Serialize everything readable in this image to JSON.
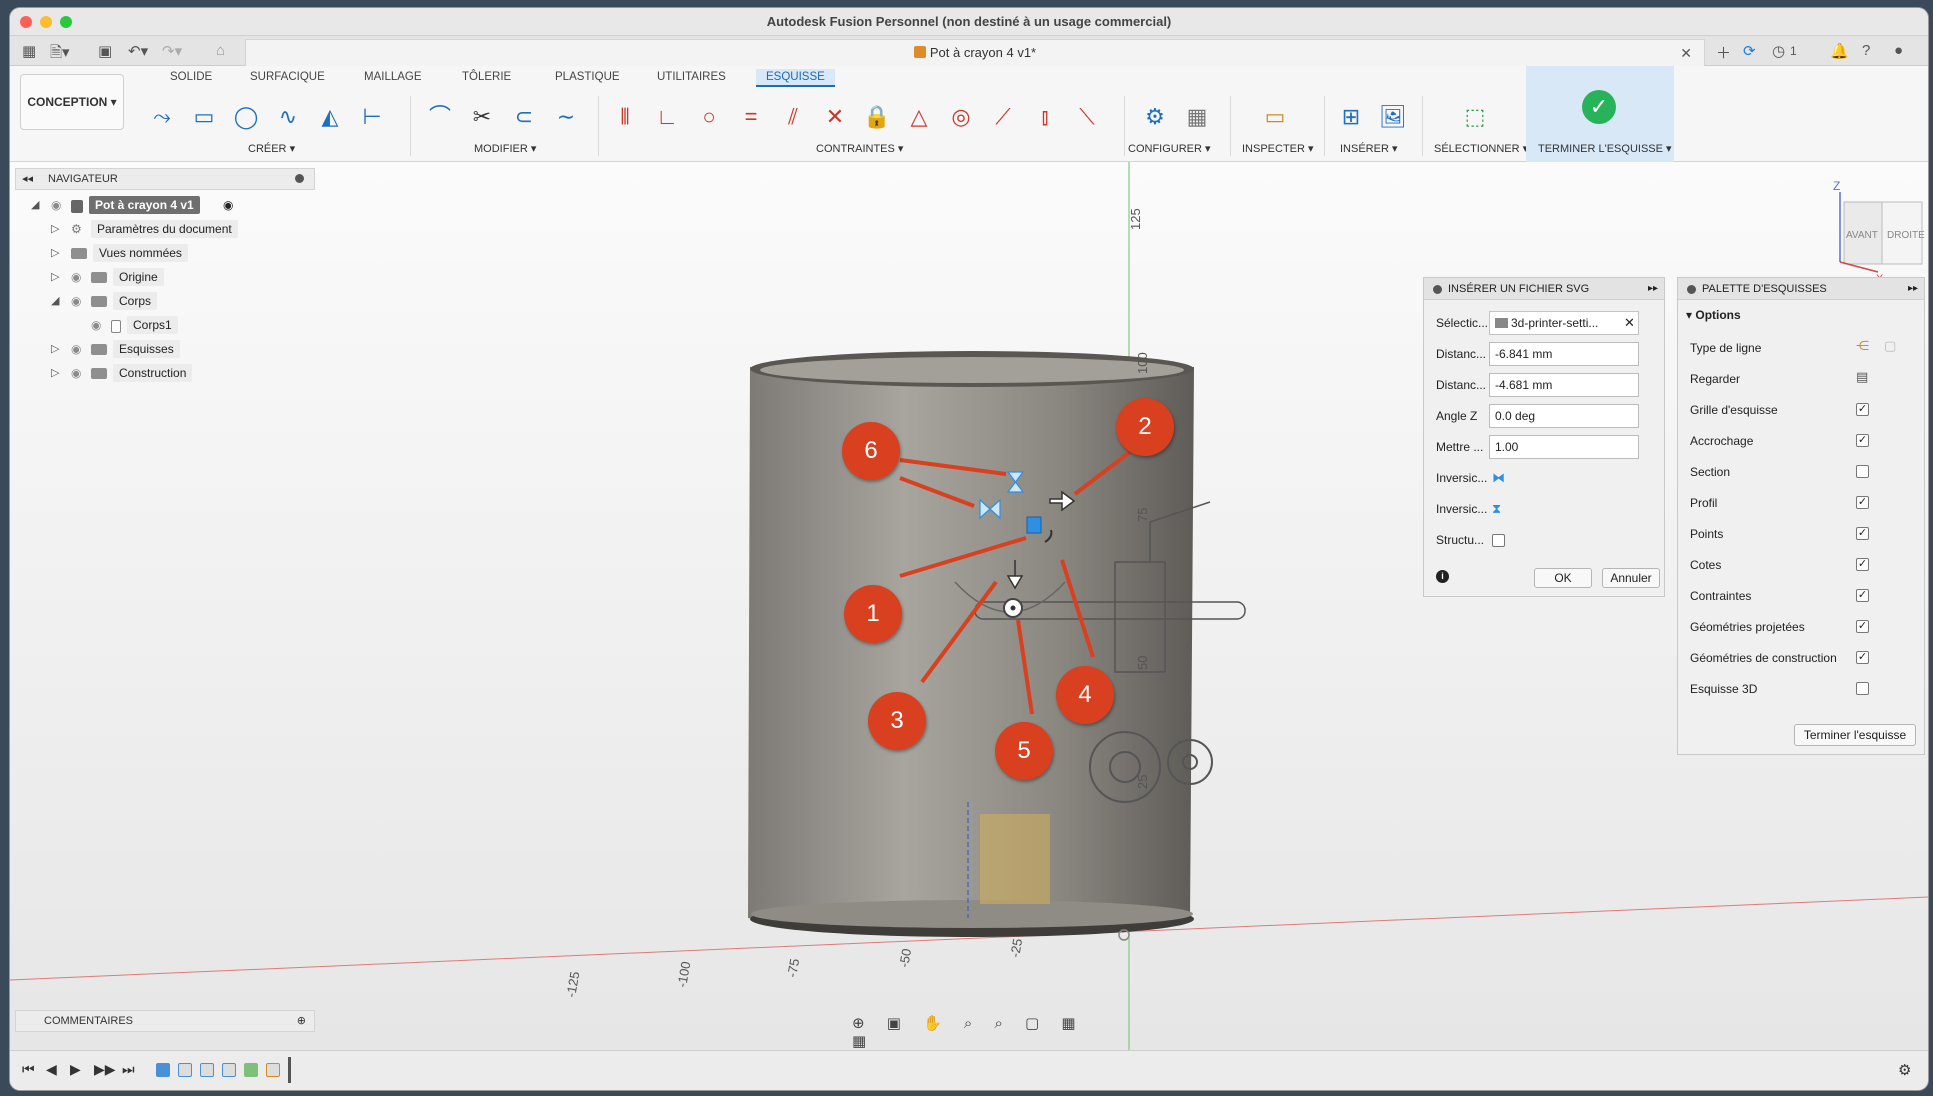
{
  "window": {
    "title": "Autodesk Fusion Personnel (non destiné à un usage commercial)"
  },
  "document_tab": {
    "title": "Pot à crayon 4 v1*"
  },
  "top_right": {
    "badge_count": "1"
  },
  "toolbar": {
    "workspace": "CONCEPTION",
    "tabs": [
      "SOLIDE",
      "SURFACIQUE",
      "MAILLAGE",
      "TÔLERIE",
      "PLASTIQUE",
      "UTILITAIRES",
      "ESQUISSE"
    ],
    "active_tab": "ESQUISSE",
    "groups": {
      "create": "CRÉER",
      "modify": "MODIFIER",
      "constraints": "CONTRAINTES",
      "configure": "CONFIGURER",
      "inspect": "INSPECTER",
      "insert": "INSÉRER",
      "select": "SÉLECTIONNER",
      "finish": "TERMINER L'ESQUISSE"
    }
  },
  "navigator": {
    "title": "NAVIGATEUR",
    "items": [
      {
        "label": "Pot à crayon 4 v1"
      },
      {
        "label": "Paramètres du document"
      },
      {
        "label": "Vues nommées"
      },
      {
        "label": "Origine"
      },
      {
        "label": "Corps"
      },
      {
        "label": "Corps1"
      },
      {
        "label": "Esquisses"
      },
      {
        "label": "Construction"
      }
    ]
  },
  "comments": {
    "title": "COMMENTAIRES"
  },
  "svg_dialog": {
    "title": "INSÉRER UN FICHIER SVG",
    "select_label": "Sélectic...",
    "file_name": "3d-printer-setti...",
    "rows": [
      {
        "label": "Distanc...",
        "value": "-6.841 mm"
      },
      {
        "label": "Distanc...",
        "value": "-4.681 mm"
      },
      {
        "label": "Angle Z",
        "value": "0.0 deg"
      },
      {
        "label": "Mettre ...",
        "value": "1.00"
      }
    ],
    "flip_h_label": "Inversic...",
    "flip_v_label": "Inversic...",
    "structure_label": "Structu...",
    "ok": "OK",
    "cancel": "Annuler"
  },
  "palette": {
    "title": "PALETTE D'ESQUISSES",
    "section": "Options",
    "line_type_label": "Type de ligne",
    "look_label": "Regarder",
    "options": [
      {
        "label": "Grille d'esquisse",
        "checked": true
      },
      {
        "label": "Accrochage",
        "checked": true
      },
      {
        "label": "Section",
        "checked": false
      },
      {
        "label": "Profil",
        "checked": true
      },
      {
        "label": "Points",
        "checked": true
      },
      {
        "label": "Cotes",
        "checked": true
      },
      {
        "label": "Contraintes",
        "checked": true
      },
      {
        "label": "Géométries projetées",
        "checked": true
      },
      {
        "label": "Géométries de construction",
        "checked": true
      },
      {
        "label": "Esquisse 3D",
        "checked": false
      }
    ],
    "finish_button": "Terminer l'esquisse"
  },
  "viewcube": {
    "front": "AVANT",
    "right": "DROITE",
    "axis_z": "Z",
    "axis_x": "X"
  },
  "axis_ticks": {
    "vertical": [
      "125",
      "100",
      "75",
      "50",
      "25"
    ],
    "horizontal": [
      "-125",
      "-100",
      "-75",
      "-50",
      "-25"
    ]
  },
  "callouts": [
    "1",
    "2",
    "3",
    "4",
    "5",
    "6"
  ],
  "colors": {
    "accent": "#1a6bb8",
    "callout": "#d8401f",
    "finish_green": "#27b35a"
  }
}
